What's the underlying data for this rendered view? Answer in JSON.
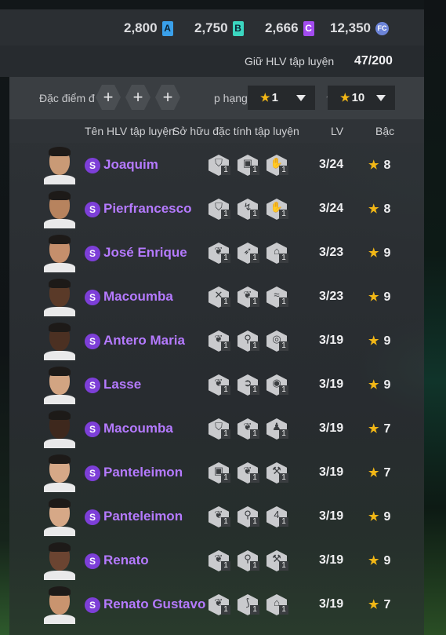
{
  "currencies": [
    {
      "value": "2,800",
      "badge": "A"
    },
    {
      "value": "2,750",
      "badge": "B"
    },
    {
      "value": "2,666",
      "badge": "C"
    },
    {
      "value": "12,350",
      "badge": "FC"
    }
  ],
  "hold": {
    "label": "Giữ HLV tập luyện",
    "count": "47/200"
  },
  "filter": {
    "trait_label": "Đặc điểm đ",
    "rank_label": "p hạng",
    "min_rank": "1",
    "max_rank": "10",
    "range_separator": "~"
  },
  "columns": {
    "name": "Tên HLV tập luyện",
    "traits": "Sở hữu đặc tính tập luyện",
    "level": "LV",
    "grade": "Bậc"
  },
  "coaches": [
    {
      "name": "Joaquim",
      "level": "3/24",
      "grade": "8",
      "traits": [
        {
          "icon": "shield-icon",
          "n": "1"
        },
        {
          "icon": "lock-icon",
          "n": "1"
        },
        {
          "icon": "hands-icon",
          "n": "1"
        }
      ]
    },
    {
      "name": "Pierfrancesco",
      "level": "3/24",
      "grade": "8",
      "traits": [
        {
          "icon": "shield-icon",
          "n": "1"
        },
        {
          "icon": "kick-icon",
          "n": "1"
        },
        {
          "icon": "hands-icon",
          "n": "1"
        }
      ]
    },
    {
      "name": "José Enrique",
      "level": "3/23",
      "grade": "9",
      "traits": [
        {
          "icon": "bird-icon",
          "n": "1"
        },
        {
          "icon": "run-icon",
          "n": "1"
        },
        {
          "icon": "cap-icon",
          "n": "1"
        }
      ]
    },
    {
      "name": "Macoumba",
      "level": "3/23",
      "grade": "9",
      "traits": [
        {
          "icon": "cross-icon",
          "n": "1"
        },
        {
          "icon": "bird-icon",
          "n": "1"
        },
        {
          "icon": "wave-icon",
          "n": "1"
        }
      ]
    },
    {
      "name": "Antero Maria",
      "level": "3/19",
      "grade": "9",
      "traits": [
        {
          "icon": "bird-icon",
          "n": "1"
        },
        {
          "icon": "pin-icon",
          "n": "1"
        },
        {
          "icon": "ball-icon",
          "n": "1"
        }
      ]
    },
    {
      "name": "Lasse",
      "level": "3/19",
      "grade": "9",
      "traits": [
        {
          "icon": "bird-icon",
          "n": "1"
        },
        {
          "icon": "runner-icon",
          "n": "1"
        },
        {
          "icon": "target-icon",
          "n": "1"
        }
      ]
    },
    {
      "name": "Macoumba",
      "level": "3/19",
      "grade": "7",
      "traits": [
        {
          "icon": "shield-icon",
          "n": "1"
        },
        {
          "icon": "bird-icon",
          "n": "1"
        },
        {
          "icon": "person-icon",
          "n": "1"
        }
      ]
    },
    {
      "name": "Panteleimon",
      "level": "3/19",
      "grade": "7",
      "traits": [
        {
          "icon": "lock-icon",
          "n": "1"
        },
        {
          "icon": "bird-icon",
          "n": "1"
        },
        {
          "icon": "tools-icon",
          "n": "1"
        }
      ]
    },
    {
      "name": "Panteleimon",
      "level": "3/19",
      "grade": "9",
      "traits": [
        {
          "icon": "bird-icon",
          "n": "1"
        },
        {
          "icon": "pin-icon",
          "n": "1"
        },
        {
          "icon": "four-icon",
          "n": "1"
        }
      ]
    },
    {
      "name": "Renato",
      "level": "3/19",
      "grade": "9",
      "traits": [
        {
          "icon": "bird-icon",
          "n": "1"
        },
        {
          "icon": "pin-icon",
          "n": "1"
        },
        {
          "icon": "tools-icon",
          "n": "1"
        }
      ]
    },
    {
      "name": "Renato Gustavo",
      "level": "3/19",
      "grade": "7",
      "traits": [
        {
          "icon": "bird-icon",
          "n": "1"
        },
        {
          "icon": "hook-icon",
          "n": "1"
        },
        {
          "icon": "cap-icon",
          "n": "1"
        }
      ]
    }
  ],
  "colors": {
    "accent_purple": "#b57aff",
    "star": "#f2b716"
  }
}
